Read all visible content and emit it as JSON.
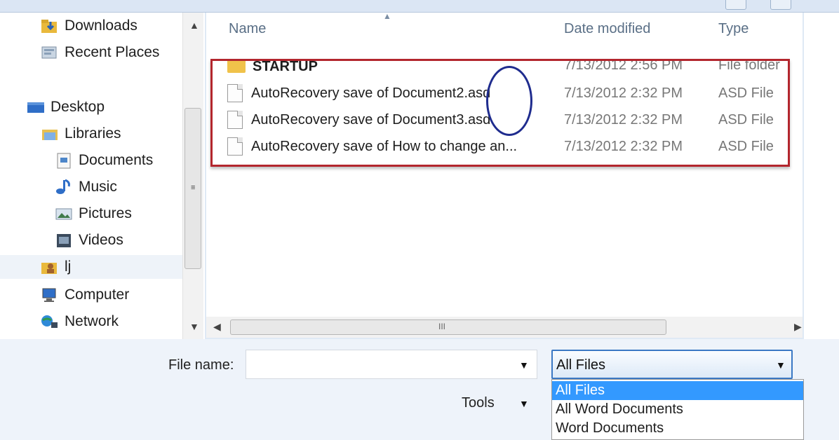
{
  "nav": {
    "items": [
      {
        "label": "Downloads",
        "icon": "downloads-folder-icon"
      },
      {
        "label": "Recent Places",
        "icon": "recent-places-icon"
      },
      {
        "label": "Desktop",
        "icon": "desktop-icon"
      },
      {
        "label": "Libraries",
        "icon": "libraries-icon"
      },
      {
        "label": "Documents",
        "icon": "documents-library-icon"
      },
      {
        "label": "Music",
        "icon": "music-note-icon"
      },
      {
        "label": "Pictures",
        "icon": "pictures-icon"
      },
      {
        "label": "Videos",
        "icon": "videos-icon"
      },
      {
        "label": "lj",
        "icon": "user-folder-icon"
      },
      {
        "label": "Computer",
        "icon": "computer-icon"
      },
      {
        "label": "Network",
        "icon": "network-icon"
      }
    ]
  },
  "list": {
    "columns": {
      "name": "Name",
      "date": "Date modified",
      "type": "Type"
    },
    "rows": [
      {
        "name": "STARTUP",
        "date": "7/13/2012 2:56 PM",
        "type": "File folder",
        "icon": "folder-icon"
      },
      {
        "name": "AutoRecovery save of Document2.asd",
        "date": "7/13/2012 2:32 PM",
        "type": "ASD File",
        "icon": "file-icon"
      },
      {
        "name": "AutoRecovery save of Document3.asd",
        "date": "7/13/2012 2:32 PM",
        "type": "ASD File",
        "icon": "file-icon"
      },
      {
        "name": "AutoRecovery save of How to change an...",
        "date": "7/13/2012 2:32 PM",
        "type": "ASD File",
        "icon": "file-icon"
      }
    ]
  },
  "hscroll_grip": "III",
  "bottom": {
    "filename_label": "File name:",
    "filename_value": "",
    "tools_label": "Tools",
    "filter_selected": "All Files",
    "filter_options": [
      "All Files",
      "All Word Documents",
      "Word Documents"
    ]
  },
  "colors": {
    "highlight_box": "#b3262d",
    "annotation_oval": "#1f2c8e",
    "selection": "#3399ff"
  }
}
